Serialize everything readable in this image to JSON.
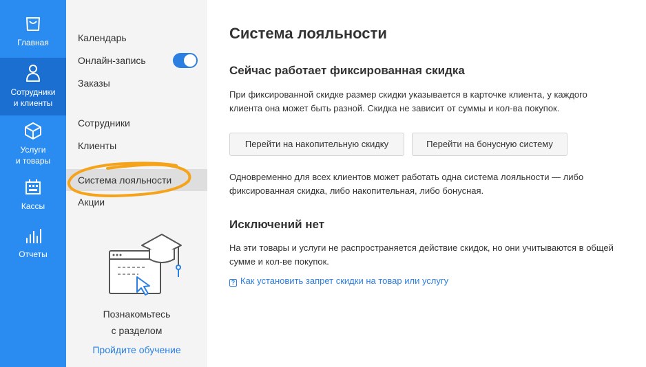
{
  "rail": {
    "items": [
      {
        "label_lines": [
          "Главная"
        ],
        "icon": "bag-icon"
      },
      {
        "label_lines": [
          "Сотрудники",
          "и клиенты"
        ],
        "icon": "person-icon"
      },
      {
        "label_lines": [
          "Услуги",
          "и товары"
        ],
        "icon": "box-icon"
      },
      {
        "label_lines": [
          "Кассы"
        ],
        "icon": "register-icon"
      },
      {
        "label_lines": [
          "Отчеты"
        ],
        "icon": "bar-chart-icon"
      }
    ]
  },
  "submenu": {
    "items": [
      {
        "label": "Календарь"
      },
      {
        "label": "Онлайн-запись",
        "toggle": "on"
      },
      {
        "label": "Заказы"
      },
      {
        "label": "Сотрудники"
      },
      {
        "label": "Клиенты"
      },
      {
        "label": "Система лояльности"
      },
      {
        "label": "Акции"
      }
    ],
    "learn": {
      "line1": "Познакомьтесь",
      "line2": "с разделом",
      "link": "Пройдите обучение"
    }
  },
  "main": {
    "title": "Система лояльности",
    "subtitle": "Сейчас работает фиксированная скидка",
    "desc_line1": "При фиксированной скидке размер скидки указывается в карточке клиента, у каждого",
    "desc_line2": "клиента она может быть разной. Скидка не зависит от суммы и кол-ва покупок.",
    "button_cumulative": "Перейти на накопительную скидку",
    "button_bonus": "Перейти на бонусную систему",
    "note_line1": "Одновременно для всех клиентов может работать одна система лояльности — либо",
    "note_line2": "фиксированная скидка, либо накопительная, либо бонусная.",
    "exceptions_title": "Исключений нет",
    "exceptions_line1": "На эти товары и услуги не распространяется действие скидок, но они учитываются в общей",
    "exceptions_line2": "сумме и кол-ве покупок.",
    "help_link": "Как установить запрет скидки на товар или услугу"
  },
  "colors": {
    "rail": "#2a8cf0",
    "rail_active": "#1a6fd0",
    "accent": "#2a7fe0",
    "annotation": "#f5a31a"
  }
}
